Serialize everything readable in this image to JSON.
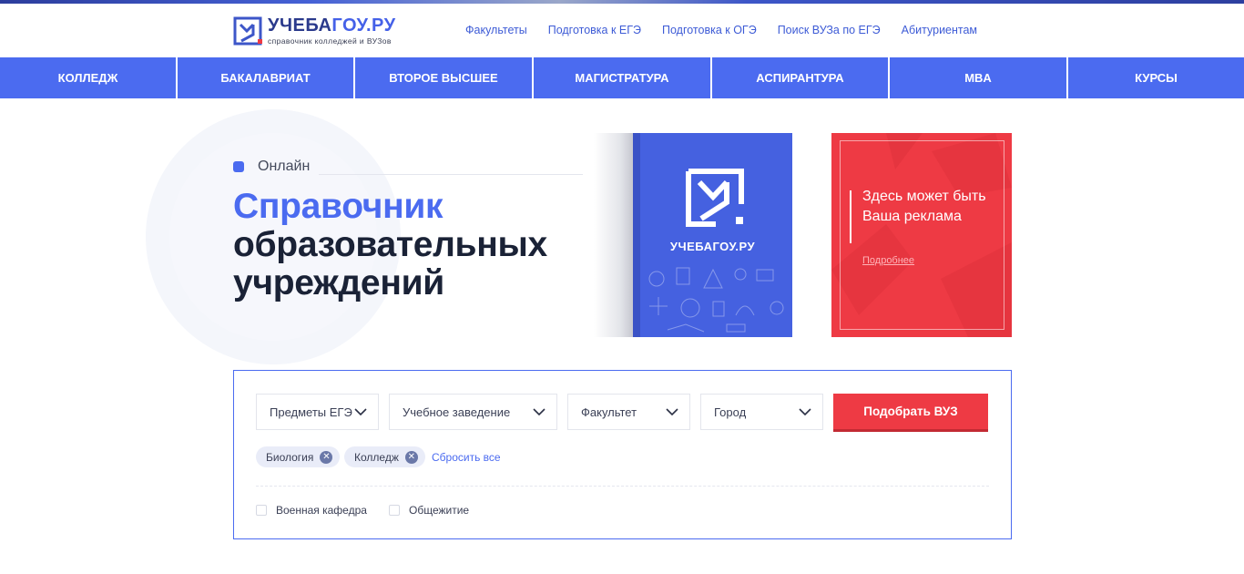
{
  "header": {
    "logo": {
      "title_main": "УЧЕБА",
      "title_accent": "ГОУ.РУ",
      "subtitle": "справочник колледжей и ВУЗов"
    },
    "top_nav": [
      {
        "label": "Факультеты"
      },
      {
        "label": "Подготовка к ЕГЭ"
      },
      {
        "label": "Подготовка к ОГЭ"
      },
      {
        "label": "Поиск ВУЗа по ЕГЭ"
      },
      {
        "label": "Абитуриентам"
      }
    ]
  },
  "main_nav": [
    {
      "label": "КОЛЛЕДЖ"
    },
    {
      "label": "БАКАЛАВРИАТ"
    },
    {
      "label": "ВТОРОЕ ВЫСШЕЕ"
    },
    {
      "label": "МАГИСТРАТУРА"
    },
    {
      "label": "АСПИРАНТУРА"
    },
    {
      "label": "MBA"
    },
    {
      "label": "КУРСЫ"
    }
  ],
  "hero": {
    "online_label": "Онлайн",
    "title_line1": "Справочник",
    "title_line2": "образовательных",
    "title_line3": "учреждений"
  },
  "book": {
    "title": "УЧЕБАГОУ.РУ"
  },
  "ad": {
    "text": "Здесь может быть Ваша реклама",
    "more_link": "Подробнее"
  },
  "filter": {
    "selects": [
      {
        "value": "Предметы ЕГЭ"
      },
      {
        "value": "Учебное заведение"
      },
      {
        "value": "Факультет"
      },
      {
        "value": "Город"
      }
    ],
    "submit_label": "Подобрать ВУЗ",
    "chips": [
      {
        "label": "Биология"
      },
      {
        "label": "Колледж"
      }
    ],
    "chip_remove_glyph": "✕",
    "reset_label": "Сбросить все",
    "checkboxes": [
      {
        "label": "Военная кафедра",
        "checked": false
      },
      {
        "label": "Общежитие",
        "checked": false
      }
    ]
  },
  "colors": {
    "brand_blue": "#4b6bf0",
    "accent_red": "#ee3a44",
    "dark_text": "#1a2236"
  }
}
